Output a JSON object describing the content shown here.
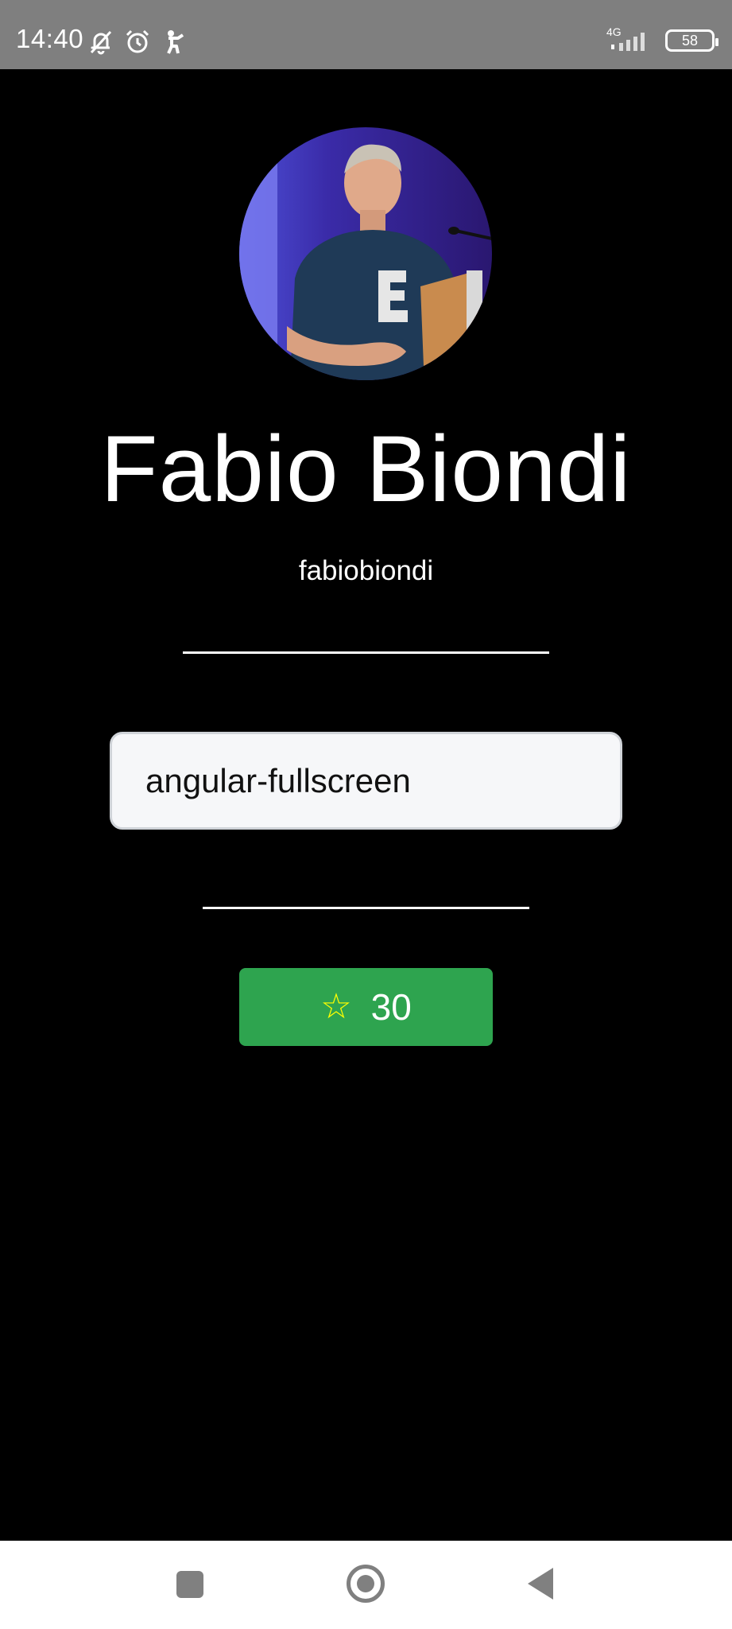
{
  "status_bar": {
    "time": "14:40",
    "network": "4G",
    "battery": "58",
    "icons": [
      "bell-off-icon",
      "alarm-icon",
      "accessibility-icon",
      "signal-icon",
      "battery-icon"
    ]
  },
  "profile": {
    "name": "Fabio Biondi",
    "username": "fabiobiondi",
    "avatar": "profile-photo"
  },
  "repo": {
    "value": "angular-fullscreen"
  },
  "stars": {
    "icon": "☆",
    "count": "30",
    "button_color": "#2ea44f",
    "icon_color": "#ffff00"
  },
  "nav_bar": {
    "buttons": [
      "recents-icon",
      "home-icon",
      "back-icon"
    ]
  }
}
